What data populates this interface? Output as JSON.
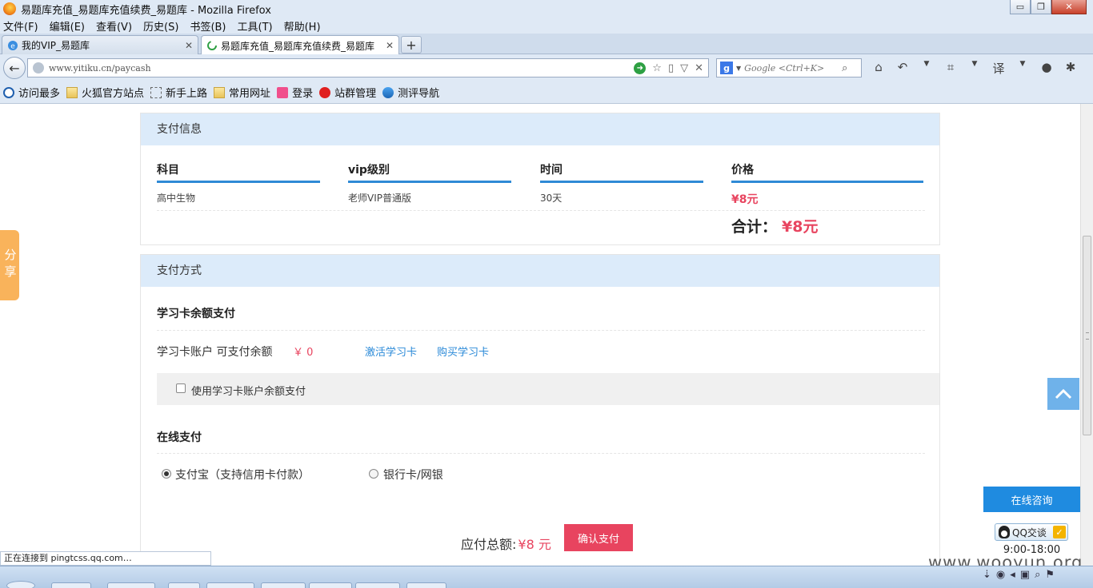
{
  "window": {
    "title": "易题库充值_易题库充值续费_易题库 - Mozilla Firefox",
    "controls": {
      "minimize": "▭",
      "restore": "❐",
      "close": "✕"
    }
  },
  "menu": [
    "文件(F)",
    "编辑(E)",
    "查看(V)",
    "历史(S)",
    "书签(B)",
    "工具(T)",
    "帮助(H)"
  ],
  "tabs": [
    {
      "label": "我的VIP_易题库",
      "active": false
    },
    {
      "label": "易题库充值_易题库充值续费_易题库",
      "active": true
    }
  ],
  "new_tab": "+",
  "address": {
    "url": "www.yitiku.cn/paycash"
  },
  "search": {
    "placeholder": "Google <Ctrl+K>"
  },
  "bookmarks": [
    {
      "label": "访问最多",
      "icon": "search-icon"
    },
    {
      "label": "火狐官方站点",
      "icon": "folder-icon"
    },
    {
      "label": "新手上路",
      "icon": "page-icon"
    },
    {
      "label": "常用网址",
      "icon": "folder-icon"
    },
    {
      "label": "登录",
      "icon": "pink-icon"
    },
    {
      "label": "站群管理",
      "icon": "red-icon"
    },
    {
      "label": "测评导航",
      "icon": "globe-icon"
    }
  ],
  "payment_info": {
    "header": "支付信息",
    "columns": [
      "科目",
      "vip级别",
      "时间",
      "价格"
    ],
    "row": [
      "高中生物",
      "老师VIP普通版",
      "30天",
      "¥8元"
    ],
    "total_label": "合计：",
    "total_value": "¥8元"
  },
  "payment_method": {
    "header": "支付方式",
    "card_section_title": "学习卡余额支付",
    "account_label": "学习卡账户  可支付余额",
    "account_balance": "￥ 0",
    "activate_link": "激活学习卡",
    "buy_link": "购买学习卡",
    "use_balance_label": "使用学习卡账户余额支付",
    "use_balance_checked": false,
    "online_title": "在线支付",
    "options": [
      {
        "label": "支付宝（支持信用卡付款）",
        "selected": true
      },
      {
        "label": "银行卡/网银",
        "selected": false
      }
    ],
    "due_label": "应付总额:",
    "due_value": "¥8 元",
    "confirm_button": "确认支付"
  },
  "share_tab": "分享",
  "consult": {
    "header": "在线咨询",
    "qq_label": "QQ交谈",
    "hours": "9:00-18:00"
  },
  "status": "正在连接到 pingtcss.qq.com…",
  "watermark": "www.wooyun.org",
  "colors": {
    "accent_blue": "#2f8ad6",
    "header_blue": "#dcebfa",
    "price_red": "#e8445f",
    "share_orange": "#f9b35b",
    "consult_blue": "#1f8be0"
  }
}
